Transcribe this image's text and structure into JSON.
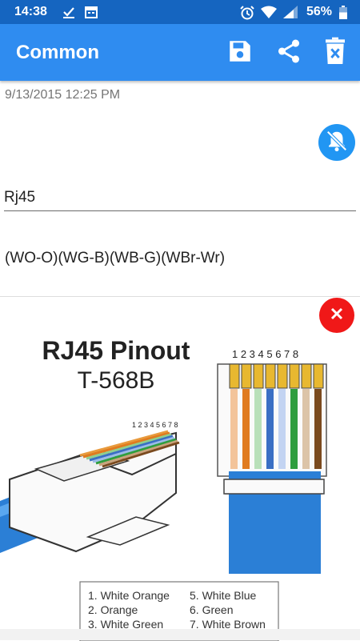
{
  "status_bar": {
    "time": "14:38",
    "battery": "56%",
    "icons": [
      "download-done-icon",
      "calendar-icon",
      "alarm-icon",
      "wifi-icon",
      "signal-icon",
      "battery-icon"
    ]
  },
  "app_bar": {
    "title": "Common",
    "actions": [
      "save-icon",
      "share-icon",
      "delete-icon"
    ],
    "color": "#2f8cf0"
  },
  "note": {
    "date": "9/13/2015 12:25 PM",
    "title_value": "Rj45",
    "body": "(WO-O)(WG-B)(WB-G)(WBr-Wr)"
  },
  "image": {
    "heading": "RJ45 Pinout",
    "subheading": "T-568B",
    "pin_numbers": [
      "1",
      "2",
      "3",
      "4",
      "5",
      "6",
      "7",
      "8"
    ],
    "legend_left": [
      "1. White Orange",
      "2. Orange",
      "3. White Green"
    ],
    "legend_right": [
      "5. White Blue",
      "6. Green",
      "7. White Brown"
    ]
  },
  "colors": {
    "status_bar": "#1565c0",
    "accent": "#2196f3",
    "close": "#f01818"
  }
}
